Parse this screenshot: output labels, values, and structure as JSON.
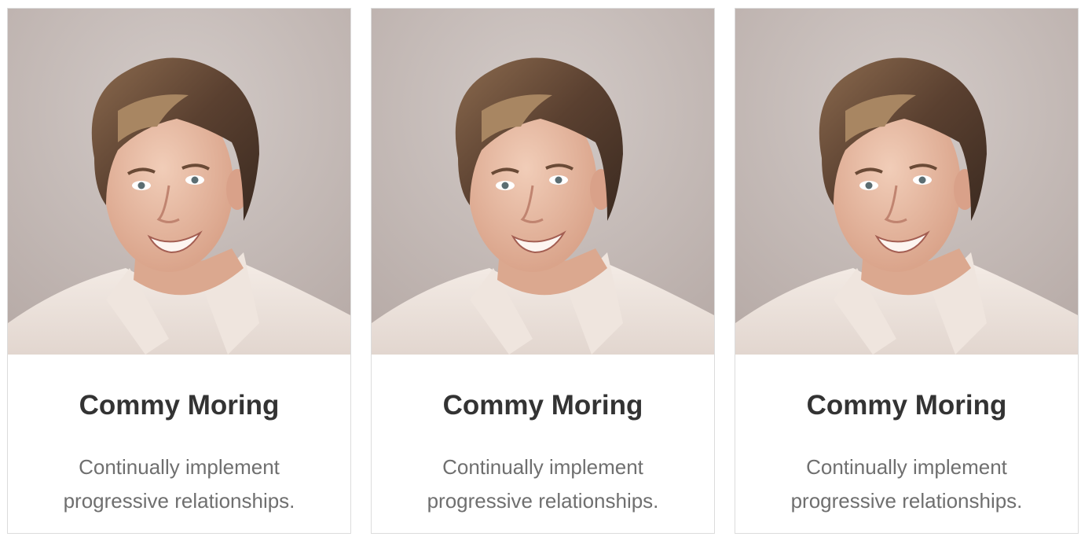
{
  "team": {
    "members": [
      {
        "name": "Commy Moring",
        "description": "Continually implement progressive relationships.",
        "photo": "portrait-photo"
      },
      {
        "name": "Commy Moring",
        "description": "Continually implement progressive relationships.",
        "photo": "portrait-photo"
      },
      {
        "name": "Commy Moring",
        "description": "Continually implement progressive relationships.",
        "photo": "portrait-photo"
      }
    ]
  },
  "colors": {
    "card_border": "#dcdcdc",
    "name_text": "#333333",
    "description_text": "#6f6f6f",
    "photo_background": "#c9bfbb"
  }
}
